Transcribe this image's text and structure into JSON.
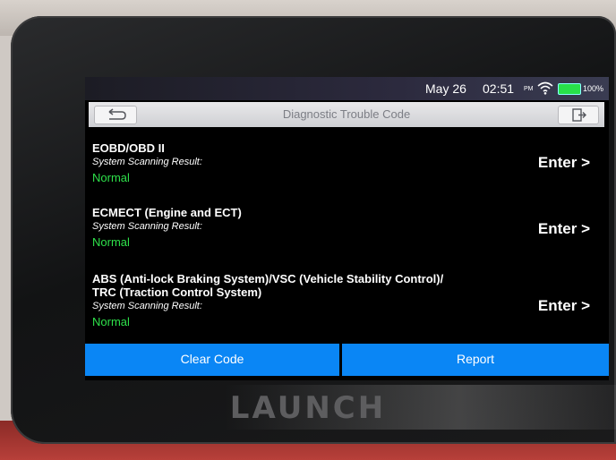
{
  "status_bar": {
    "date": "May 26",
    "time": "02:51",
    "ampm": "PM",
    "battery": "100%"
  },
  "title": "Diagnostic Trouble Code",
  "items": [
    {
      "name": "EOBD/OBD II",
      "label": "System Scanning Result:",
      "status": "Normal",
      "enter": "Enter >"
    },
    {
      "name": "ECMECT (Engine and ECT)",
      "label": "System Scanning Result:",
      "status": "Normal",
      "enter": "Enter >"
    },
    {
      "name_line1": "ABS (Anti-lock Braking System)/VSC (Vehicle Stability Control)/",
      "name_line2": "TRC (Traction Control System)",
      "label": "System Scanning Result:",
      "status": "Normal",
      "enter": "Enter >"
    }
  ],
  "buttons": {
    "clear": "Clear Code",
    "report": "Report"
  },
  "brand": "LAUNCH",
  "colors": {
    "accent": "#0a86f5",
    "status_ok": "#2ee04a"
  }
}
